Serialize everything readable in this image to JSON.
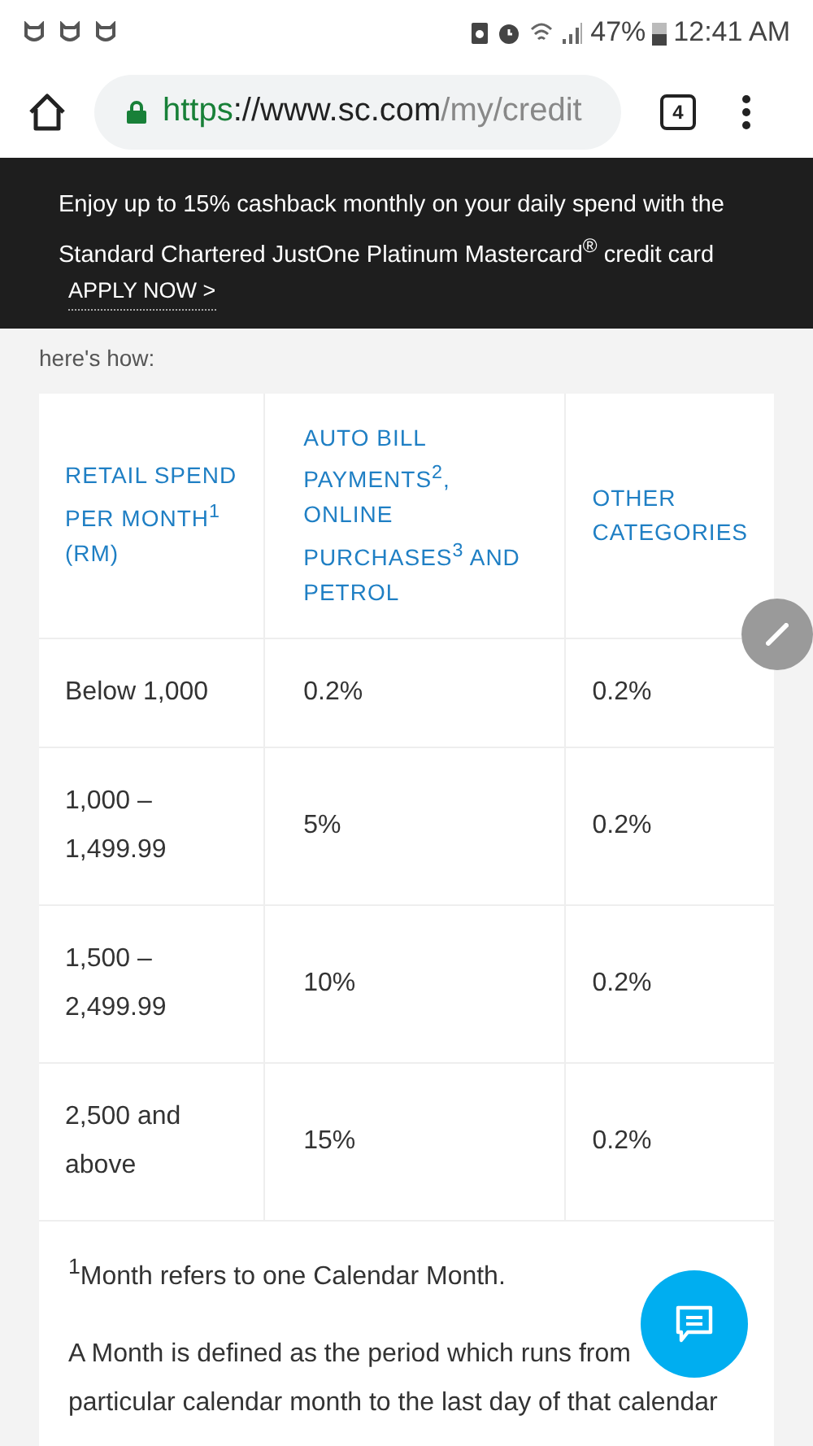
{
  "status_bar": {
    "battery": "47%",
    "time": "12:41 AM"
  },
  "browser": {
    "url_scheme": "https",
    "url_host": "://www.sc.com",
    "url_path": "/my/credit",
    "tab_count": "4"
  },
  "banner": {
    "text": "Enjoy up to 15% cashback monthly on your daily spend with the Standard Chartered JustOne Platinum Mastercard$^{®}$ credit card",
    "link": "APPLY NOW",
    "link_arrow": ">"
  },
  "intro": "here's how:",
  "table": {
    "columns": [
      "RETAIL SPEND PER MONTH$^{1}$ (RM)",
      "AUTO BILL PAYMENTS$^{2}$, ONLINE PURCHASES$^{3}$ AND PETROL",
      "OTHER CATEGORIES"
    ],
    "rows": [
      [
        "Below 1,000",
        "0.2%",
        "0.2%"
      ],
      [
        "1,000 – 1,499.99",
        "5%",
        "0.2%"
      ],
      [
        "1,500 – 2,499.99",
        "10%",
        "0.2%"
      ],
      [
        "2,500 and above",
        "15%",
        "0.2%"
      ]
    ]
  },
  "footnotes": [
    "$^{1}$Month refers to one Calendar Month.",
    "A Month is defined as the period which runs from",
    "particular calendar month to the last   day of that calendar"
  ]
}
